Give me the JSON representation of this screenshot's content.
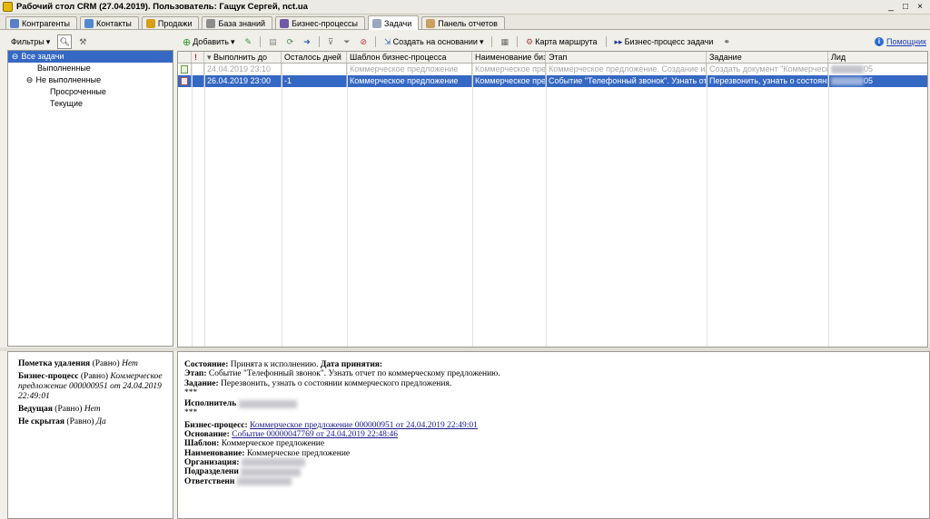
{
  "window": {
    "title": "Рабочий стол CRM (27.04.2019). Пользователь: Гащук Сергей, nct.ua",
    "buttons": [
      "_",
      "□",
      "×"
    ]
  },
  "tabs": [
    {
      "label": "Контрагенты",
      "icon": "people-icon",
      "color": "#5a7fc4"
    },
    {
      "label": "Контакты",
      "icon": "contacts-icon",
      "color": "#4f8ad1"
    },
    {
      "label": "Продажи",
      "icon": "sales-icon",
      "color": "#d4a017"
    },
    {
      "label": "База знаний",
      "icon": "knowledge-base-icon",
      "color": "#8c8c8c"
    },
    {
      "label": "Бизнес-процессы",
      "icon": "business-process-icon",
      "color": "#6f5aa8"
    },
    {
      "label": "Задачи",
      "icon": "tasks-icon",
      "color": "#9aa8c0",
      "active": true
    },
    {
      "label": "Панель отчетов",
      "icon": "reports-panel-icon",
      "color": "#c8a060"
    }
  ],
  "left_toolbar": {
    "filters_label": "Фильтры"
  },
  "tree": [
    {
      "label": "Все задачи",
      "level": 0,
      "toggle": "⊖",
      "selected": true
    },
    {
      "label": "Выполненные",
      "level": 1,
      "toggle": ""
    },
    {
      "label": "Не выполненные",
      "level": 1,
      "toggle": "⊖"
    },
    {
      "label": "Просроченные",
      "level": 2,
      "toggle": ""
    },
    {
      "label": "Текущие",
      "level": 2,
      "toggle": ""
    }
  ],
  "toolbar": {
    "add_label": "Добавить",
    "create_based_label": "Создать на основании",
    "route_map_label": "Карта маршрута",
    "bp_tasks_label": "Бизнес-процесс задачи",
    "help_label": "Помощник"
  },
  "grid": {
    "columns": [
      "",
      "",
      "Выполнить до",
      "Осталось дней",
      "Шаблон бизнес-процесса",
      "Наименование бизнес-процесса",
      "Этап",
      "Задание",
      "Лид"
    ],
    "rows": [
      {
        "state": "past",
        "due": "24.04.2019 23:10",
        "days_left": "",
        "template": "Коммерческое предложение",
        "bp_name": "Коммерческое предложение",
        "stage": "Коммерческое предложение. Создание или корректировка",
        "task": "Создать документ \"Коммерческое предложение\"",
        "lead_suffix": "05"
      },
      {
        "state": "selected",
        "due": "26.04.2019 23:00",
        "days_left": "-1",
        "template": "Коммерческое предложение",
        "bp_name": "Коммерческое предложение",
        "stage": "Событие \"Телефонный звонок\". Узнать отчет по коммерческому предложению",
        "task": "Перезвонить, узнать о состоянии коммерческого предложения",
        "lead_suffix": "05"
      }
    ]
  },
  "props": {
    "deletion_mark": {
      "label": "Пометка удаления",
      "op": "(Равно)",
      "value": "Нет"
    },
    "business_process": {
      "label": "Бизнес-процесс",
      "op": "(Равно)",
      "value": "Коммерческое предложение 000000951 от 24.04.2019 22:49:01"
    },
    "leading": {
      "label": "Ведущая",
      "op": "(Равно)",
      "value": "Нет"
    },
    "not_hidden": {
      "label": "Не скрытая",
      "op": "(Равно)",
      "value": "Да"
    }
  },
  "details": {
    "state_label": "Состояние:",
    "state_value": "Принята к исполнению.",
    "accept_date_label": "Дата принятия:",
    "stage_label": "Этап:",
    "stage_value": "Событие \"Телефонный звонок\". Узнать отчет по коммерческому предложению.",
    "task_label": "Задание:",
    "task_value": "Перезвонить, узнать о состоянии коммерческого предложения.",
    "stars": "***",
    "executor_label": "Исполнитель",
    "bp_label": "Бизнес-процесс:",
    "bp_link": "Коммерческое предложение 000000951 от 24.04.2019 22:49:01",
    "basis_label": "Основание:",
    "basis_link": "Событие 00000047769 от 24.04.2019 22:48:46",
    "template_label": "Шаблон:",
    "template_value": "Коммерческое предложение",
    "name_label": "Наименование:",
    "name_value": "Коммерческое предложение",
    "org_label": "Организация:",
    "dept_label": "Подразделени",
    "resp_label": "Ответственн"
  }
}
